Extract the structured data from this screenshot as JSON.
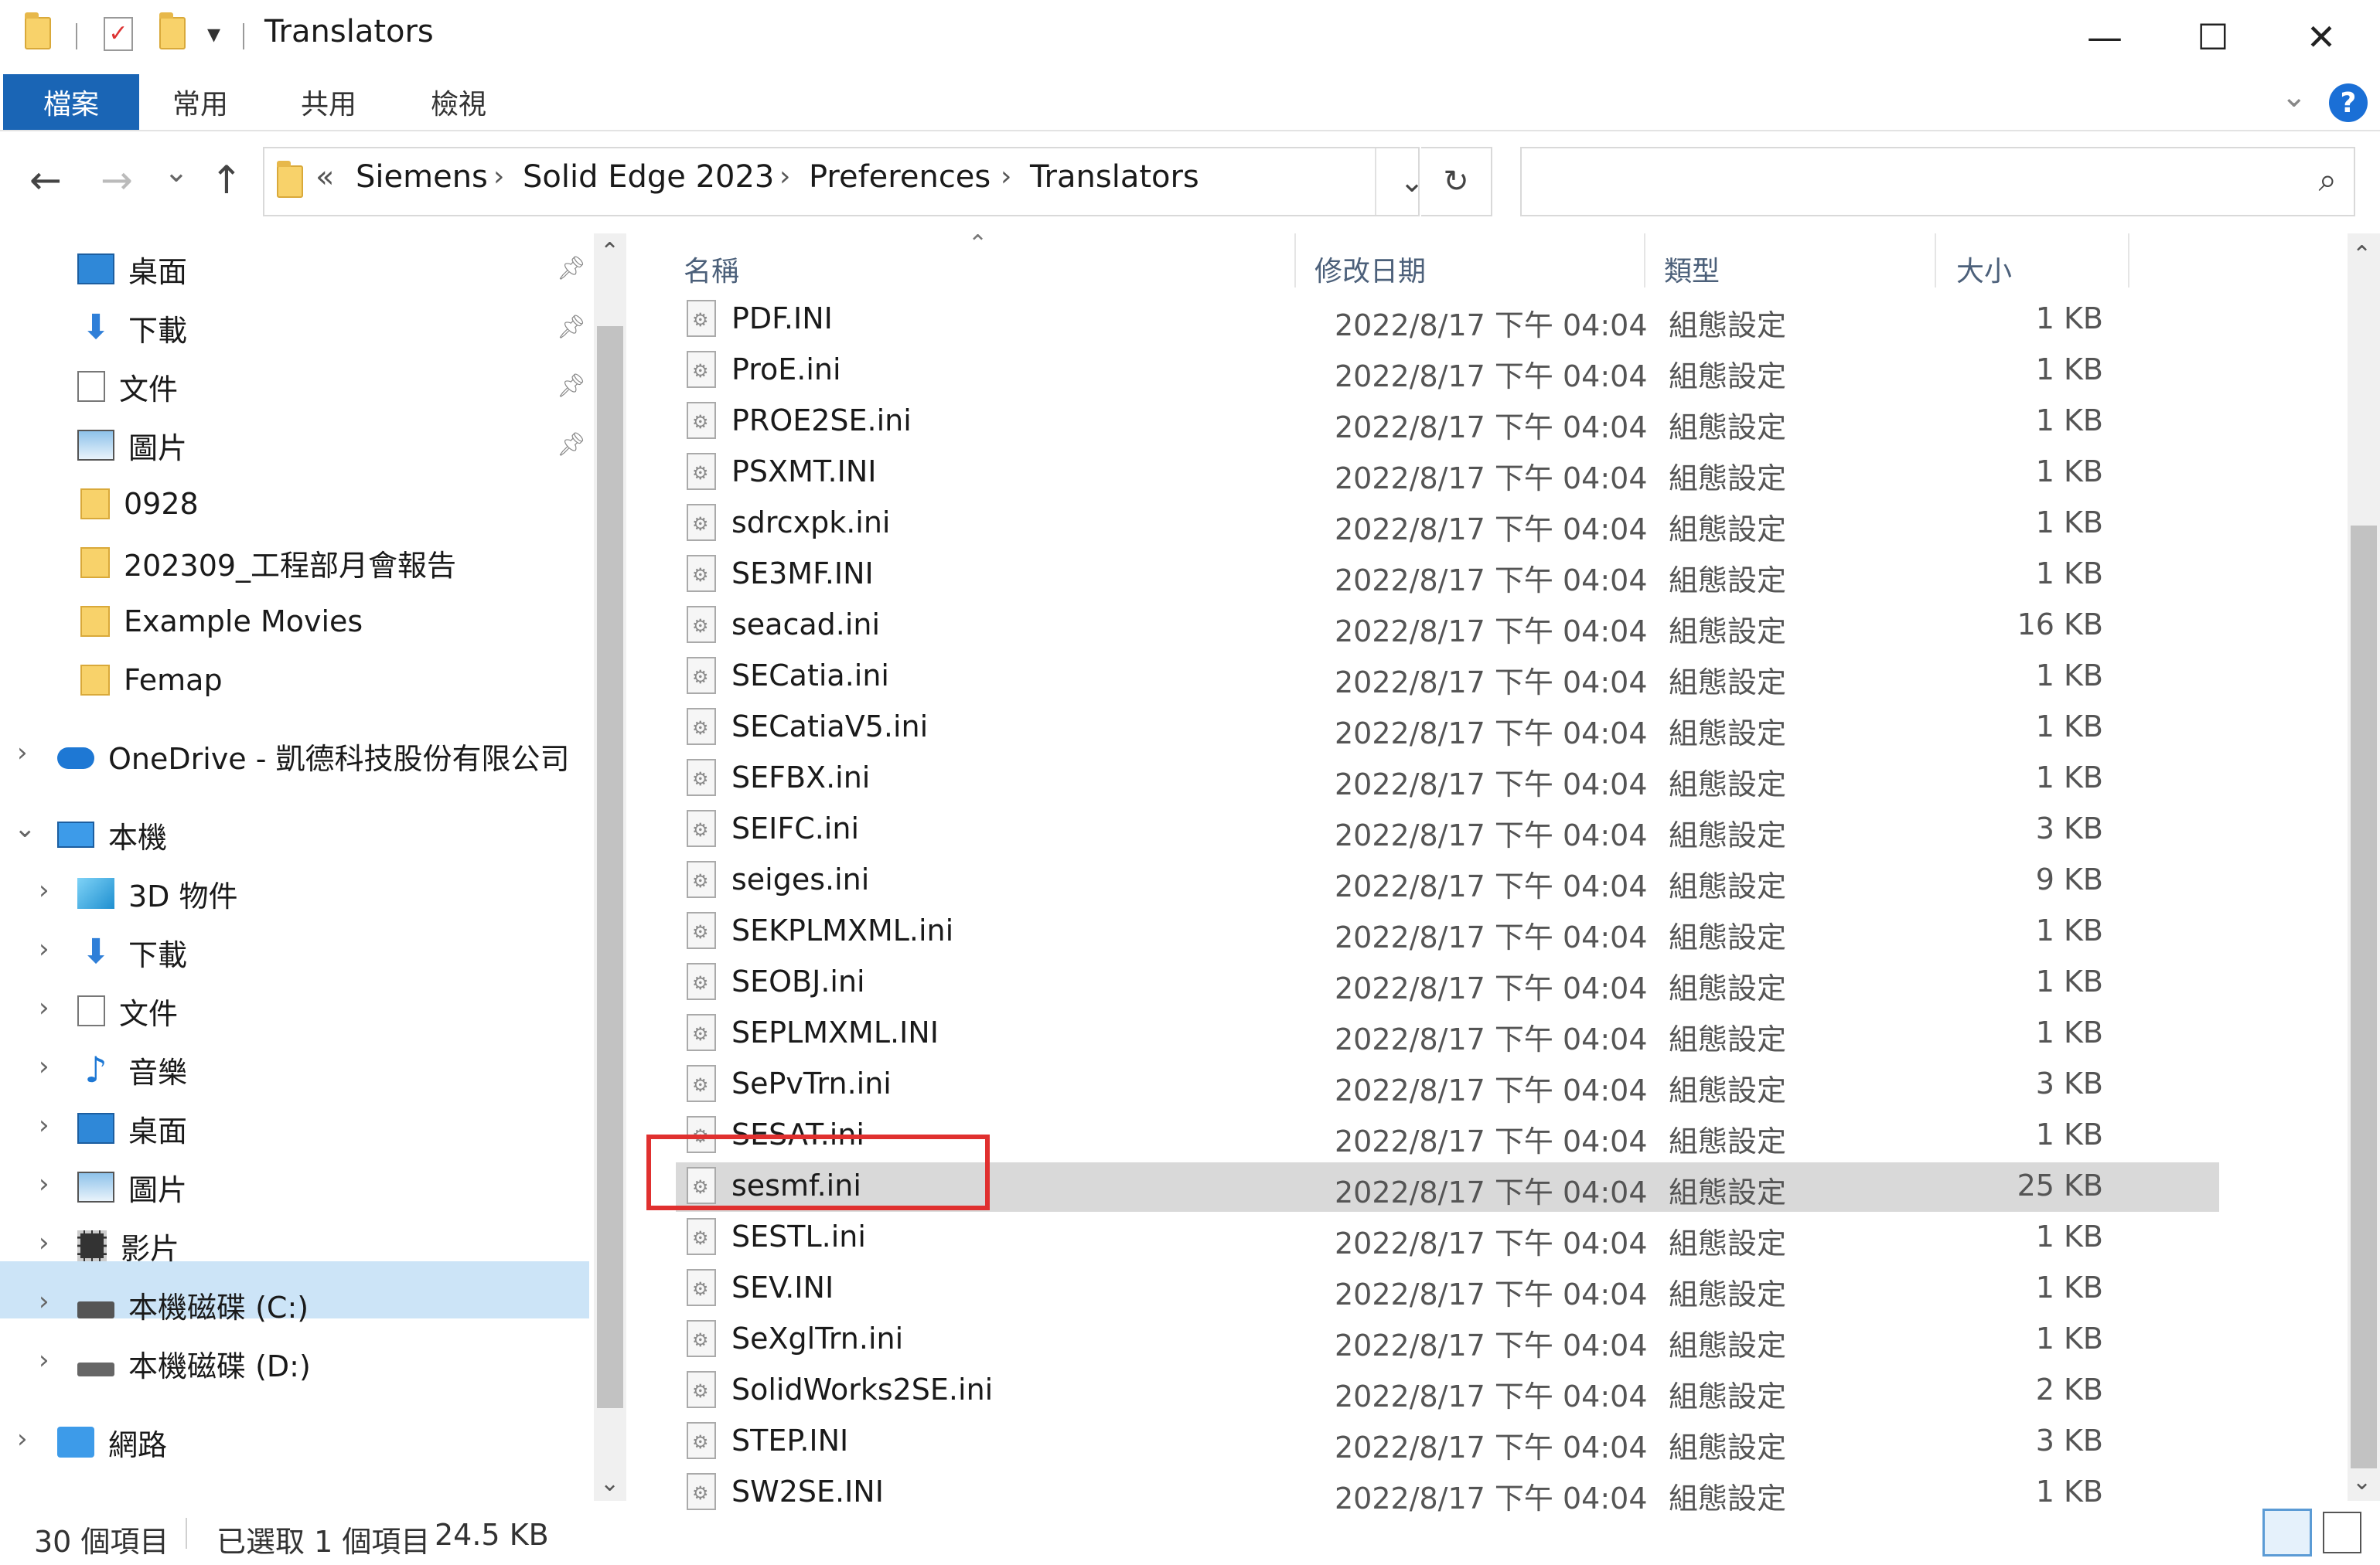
{
  "titlebar": {
    "title": "Translators",
    "quick_access": [
      "folder-icon",
      "properties-check-icon",
      "new-folder-icon",
      "customize-dropdown-icon"
    ],
    "window_controls": {
      "minimize": "—",
      "maximize": "☐",
      "close": "✕"
    }
  },
  "ribbon": {
    "tabs": [
      {
        "label": "檔案",
        "active": true
      },
      {
        "label": "常用"
      },
      {
        "label": "共用"
      },
      {
        "label": "檢視"
      }
    ],
    "help": "?"
  },
  "navigation": {
    "back": "←",
    "forward": "→",
    "recent": "⌄",
    "up": "↑",
    "overflow": "«",
    "breadcrumb": [
      "Siemens",
      "Solid Edge 2023",
      "Preferences",
      "Translators"
    ],
    "refresh": "↻",
    "search_placeholder": ""
  },
  "sidebar": {
    "quick_access": [
      {
        "label": "桌面",
        "icon": "desktop-icon",
        "pinned": true
      },
      {
        "label": "下載",
        "icon": "download-icon",
        "pinned": true
      },
      {
        "label": "文件",
        "icon": "documents-icon",
        "pinned": true
      },
      {
        "label": "圖片",
        "icon": "pictures-icon",
        "pinned": true
      },
      {
        "label": "0928",
        "icon": "folder-icon"
      },
      {
        "label": "202309_工程部月會報告",
        "icon": "folder-icon"
      },
      {
        "label": "Example Movies",
        "icon": "folder-icon"
      },
      {
        "label": "Femap",
        "icon": "folder-icon"
      }
    ],
    "onedrive": {
      "label": "OneDrive - 凱德科技股份有限公司",
      "icon": "cloud-icon"
    },
    "this_pc": {
      "label": "本機",
      "icon": "computer-icon"
    },
    "this_pc_items": [
      {
        "label": "3D 物件",
        "icon": "3d-objects-icon"
      },
      {
        "label": "下載",
        "icon": "download-icon"
      },
      {
        "label": "文件",
        "icon": "documents-icon"
      },
      {
        "label": "音樂",
        "icon": "music-icon"
      },
      {
        "label": "桌面",
        "icon": "desktop-icon"
      },
      {
        "label": "圖片",
        "icon": "pictures-icon"
      },
      {
        "label": "影片",
        "icon": "videos-icon"
      },
      {
        "label": "本機磁碟 (C:)",
        "icon": "drive-c-icon",
        "selected": true
      },
      {
        "label": "本機磁碟 (D:)",
        "icon": "drive-d-icon"
      }
    ],
    "network": {
      "label": "網路",
      "icon": "network-icon"
    }
  },
  "file_list": {
    "columns": {
      "name": "名稱",
      "date": "修改日期",
      "type": "類型",
      "size": "大小"
    },
    "files": [
      {
        "name": "PDF.INI",
        "date": "2022/8/17 下午 04:04",
        "type": "組態設定",
        "size": "1 KB"
      },
      {
        "name": "ProE.ini",
        "date": "2022/8/17 下午 04:04",
        "type": "組態設定",
        "size": "1 KB"
      },
      {
        "name": "PROE2SE.ini",
        "date": "2022/8/17 下午 04:04",
        "type": "組態設定",
        "size": "1 KB"
      },
      {
        "name": "PSXMT.INI",
        "date": "2022/8/17 下午 04:04",
        "type": "組態設定",
        "size": "1 KB"
      },
      {
        "name": "sdrcxpk.ini",
        "date": "2022/8/17 下午 04:04",
        "type": "組態設定",
        "size": "1 KB"
      },
      {
        "name": "SE3MF.INI",
        "date": "2022/8/17 下午 04:04",
        "type": "組態設定",
        "size": "1 KB"
      },
      {
        "name": "seacad.ini",
        "date": "2022/8/17 下午 04:04",
        "type": "組態設定",
        "size": "16 KB"
      },
      {
        "name": "SECatia.ini",
        "date": "2022/8/17 下午 04:04",
        "type": "組態設定",
        "size": "1 KB"
      },
      {
        "name": "SECatiaV5.ini",
        "date": "2022/8/17 下午 04:04",
        "type": "組態設定",
        "size": "1 KB"
      },
      {
        "name": "SEFBX.ini",
        "date": "2022/8/17 下午 04:04",
        "type": "組態設定",
        "size": "1 KB"
      },
      {
        "name": "SEIFC.ini",
        "date": "2022/8/17 下午 04:04",
        "type": "組態設定",
        "size": "3 KB"
      },
      {
        "name": "seiges.ini",
        "date": "2022/8/17 下午 04:04",
        "type": "組態設定",
        "size": "9 KB"
      },
      {
        "name": "SEKPLMXML.ini",
        "date": "2022/8/17 下午 04:04",
        "type": "組態設定",
        "size": "1 KB"
      },
      {
        "name": "SEOBJ.ini",
        "date": "2022/8/17 下午 04:04",
        "type": "組態設定",
        "size": "1 KB"
      },
      {
        "name": "SEPLMXML.INI",
        "date": "2022/8/17 下午 04:04",
        "type": "組態設定",
        "size": "1 KB"
      },
      {
        "name": "SePvTrn.ini",
        "date": "2022/8/17 下午 04:04",
        "type": "組態設定",
        "size": "3 KB"
      },
      {
        "name": "SESAT.ini",
        "date": "2022/8/17 下午 04:04",
        "type": "組態設定",
        "size": "1 KB"
      },
      {
        "name": "sesmf.ini",
        "date": "2022/8/17 下午 04:04",
        "type": "組態設定",
        "size": "25 KB",
        "selected": true
      },
      {
        "name": "SESTL.ini",
        "date": "2022/8/17 下午 04:04",
        "type": "組態設定",
        "size": "1 KB"
      },
      {
        "name": "SEV.INI",
        "date": "2022/8/17 下午 04:04",
        "type": "組態設定",
        "size": "1 KB"
      },
      {
        "name": "SeXglTrn.ini",
        "date": "2022/8/17 下午 04:04",
        "type": "組態設定",
        "size": "1 KB"
      },
      {
        "name": "SolidWorks2SE.ini",
        "date": "2022/8/17 下午 04:04",
        "type": "組態設定",
        "size": "2 KB"
      },
      {
        "name": "STEP.INI",
        "date": "2022/8/17 下午 04:04",
        "type": "組態設定",
        "size": "3 KB"
      },
      {
        "name": "SW2SE.INI",
        "date": "2022/8/17 下午 04:04",
        "type": "組態設定",
        "size": "1 KB"
      }
    ]
  },
  "status": {
    "item_count": "30 個項目",
    "selection": "已選取 1 個項目",
    "selection_size": "24.5 KB"
  },
  "colors": {
    "accent": "#1a65b5",
    "selection_tree": "#cce4f7",
    "selection_row": "#d9d9d9",
    "annotation_box": "#e0302f"
  }
}
